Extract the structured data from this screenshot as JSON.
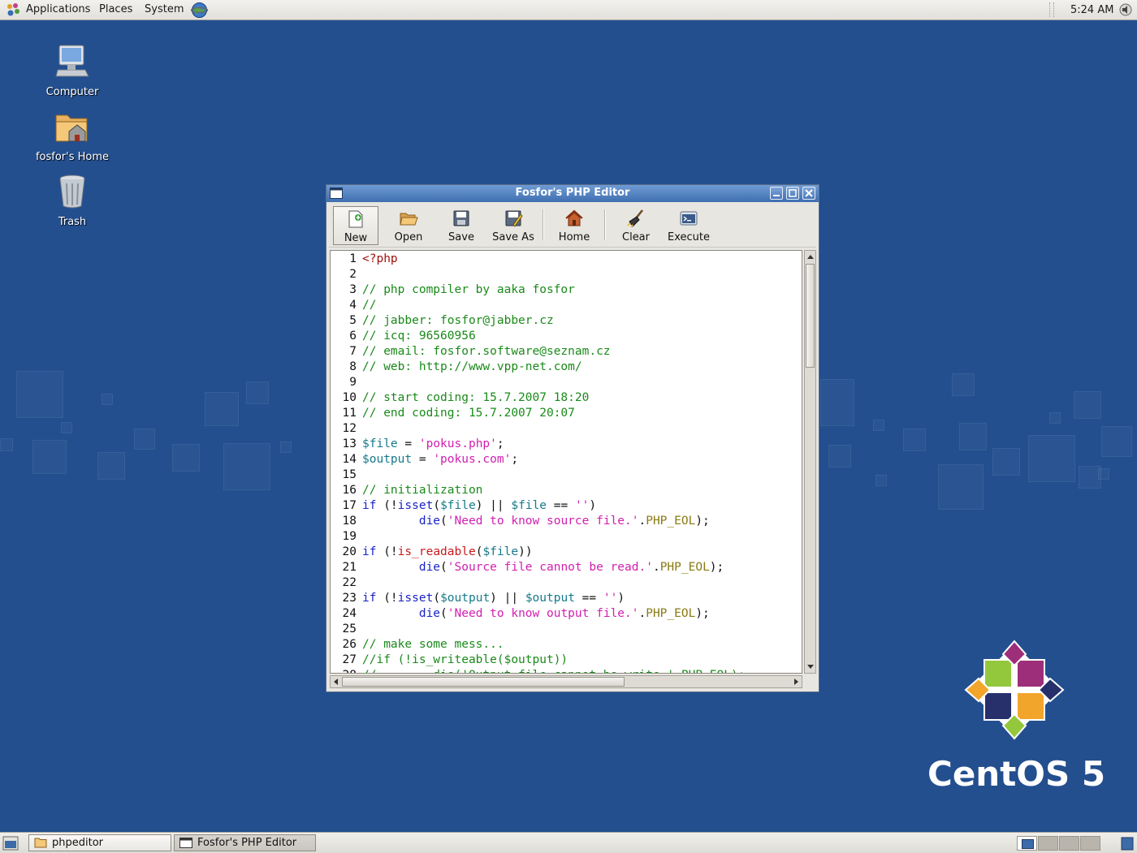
{
  "top_panel": {
    "menus": [
      "Applications",
      "Places",
      "System"
    ],
    "clock": "5:24 AM"
  },
  "desktop": {
    "icons": [
      {
        "label": "Computer"
      },
      {
        "label": "fosfor's Home"
      },
      {
        "label": "Trash"
      }
    ],
    "logo_text": "CentOS 5"
  },
  "window": {
    "title": "Fosfor's PHP Editor",
    "toolbar": {
      "new": "New",
      "open": "Open",
      "save": "Save",
      "save_as": "Save As",
      "home": "Home",
      "clear": "Clear",
      "execute": "Execute"
    },
    "code_lines": [
      "<?php",
      "",
      "// php compiler by aaka fosfor",
      "//",
      "// jabber: fosfor@jabber.cz",
      "// icq: 96560956",
      "// email: fosfor.software@seznam.cz",
      "// web: http://www.vpp-net.com/",
      "",
      "// start coding: 15.7.2007 18:20",
      "// end coding: 15.7.2007 20:07",
      "",
      "$file = 'pokus.php';",
      "$output = 'pokus.com';",
      "",
      "// initialization",
      "if (!isset($file) || $file == '')",
      "        die('Need to know source file.'.PHP_EOL);",
      "",
      "if (!is_readable($file))",
      "        die('Source file cannot be read.'.PHP_EOL);",
      "",
      "if (!isset($output) || $output == '')",
      "        die('Need to know output file.'.PHP_EOL);",
      "",
      "// make some mess...",
      "//if (!is_writeable($output))",
      "//        die('Output file cannot be write.'.PHP_EOL);"
    ]
  },
  "taskbar": {
    "tasks": [
      "phpeditor",
      "Fosfor's PHP Editor"
    ]
  },
  "colors": {
    "desktop_bg": "#234f8f",
    "comment": "#1a8a1a",
    "string": "#d11fb0",
    "variable": "#157a8a",
    "keyword": "#1a23c8",
    "function": "#c81a1a",
    "constant": "#8a7a10"
  }
}
